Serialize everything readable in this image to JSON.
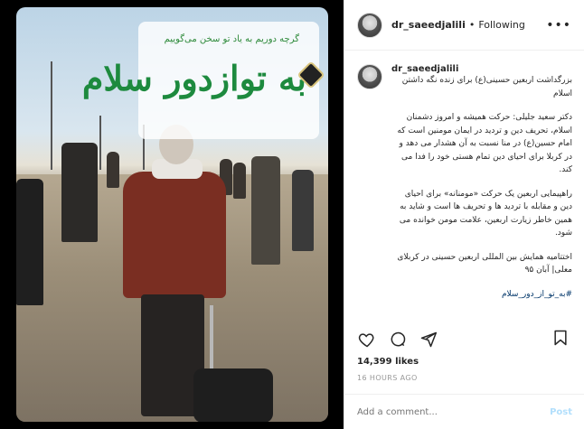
{
  "post": {
    "username": "dr_saeedjalili",
    "dot": "•",
    "follow_status": "Following",
    "more_icon": "more-horizontal-icon"
  },
  "media": {
    "banner_top_text": "گرچه دوریم به یاد تو سخن می‌گوییم",
    "banner_main_text": "به توازدور سلام"
  },
  "caption": {
    "username": "dr_saeedjalili",
    "paragraphs": [
      "بزرگداشت اربعین حسینی(ع) برای زنده نگه داشتن اسلام",
      "دکتر سعید جلیلی: حرکت همیشه و امروز دشمنان اسلام، تحریف دین و تردید در ایمان مومنین است که امام حسین(ع) در منا نسبت به آن هشدار می دهد و در کربلا برای احیای دین تمام هستی خود را فدا می کند.",
      "راهپیمایی اربعین یک حرکت «مومنانه» برای احیای دین و مقابله با تردید ها و تحریف ها است و شاید به همین خاطر زیارت اربعین، علامت مومن خوانده می شود.",
      "اختتامیه همایش بین المللی اربعین حسینی در کربلای معلی| آبان ۹۵"
    ],
    "hashtag": "#به_تو_از_دور_سلام"
  },
  "actions": {
    "like_icon": "heart-icon",
    "comment_icon": "comment-icon",
    "share_icon": "share-icon",
    "save_icon": "bookmark-icon"
  },
  "stats": {
    "likes": "14,399 likes",
    "timestamp": "16 HOURS AGO"
  },
  "comment_box": {
    "placeholder": "Add a comment...",
    "post_label": "Post"
  }
}
